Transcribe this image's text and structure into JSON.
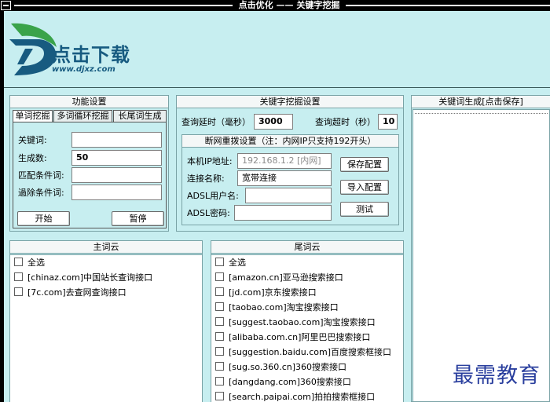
{
  "window": {
    "title": "点击优化 —— 关键字挖掘"
  },
  "logo": {
    "text": "点击下载",
    "url": "www.djxz.com"
  },
  "function_settings": {
    "title": "功能设置",
    "tabs": [
      "单词挖掘",
      "多词循环挖掘",
      "长尾词生成"
    ],
    "fields": [
      {
        "label": "关键词:",
        "value": ""
      },
      {
        "label": "生成数:",
        "value": "50"
      },
      {
        "label": "匹配条件词:",
        "value": ""
      },
      {
        "label": "過除条件词:",
        "value": ""
      }
    ],
    "start_label": "开始",
    "pause_label": "暂停"
  },
  "mining_settings": {
    "title": "关键字挖掘设置",
    "query_delay_label": "查询延时（毫秒）",
    "query_delay_value": "3000",
    "query_timeout_label": "查询超时（秒）",
    "query_timeout_value": "10",
    "redial": {
      "title": "断网重拨设置（注：内网IP只支持192开头）",
      "local_ip_label": "本机IP地址:",
      "local_ip_placeholder": "192.168.1.2 [内网]",
      "conn_name_label": "连接名称:",
      "conn_name_value": "宽带连接",
      "adsl_user_label": "ADSL用户名:",
      "adsl_user_value": "",
      "adsl_pass_label": "ADSL密码:",
      "adsl_pass_value": "",
      "save_label": "保存配置",
      "import_label": "导入配置",
      "test_label": "测试"
    }
  },
  "output": {
    "title": "关键词生成[点击保存]"
  },
  "main_cloud": {
    "title": "主词云",
    "items": [
      "全选",
      "[chinaz.com]中国站长查询接口",
      "[7c.com]去查网查询接口"
    ]
  },
  "tail_cloud": {
    "title": "尾词云",
    "items": [
      "全选",
      "[amazon.cn]亚马逊搜索接口",
      "[jd.com]京东搜索接口",
      "[taobao.com]淘宝搜索接口",
      "[suggest.taobao.com]淘宝搜索接口",
      "[alibaba.com.cn]阿里巴巴搜索接口",
      "[suggestion.baidu.com]百度搜索框接口",
      "[sug.so.360.cn]360搜索接口",
      "[dangdang.com]360搜索接口",
      "[search.paipai.com]拍拍搜索框接口"
    ]
  },
  "watermark": {
    "text": "最需教育"
  },
  "colors": {
    "background": "#c7eef0",
    "logo_blue": "#175b80",
    "logo_green": "#3aa34a",
    "watermark": "#2a3f9e"
  }
}
